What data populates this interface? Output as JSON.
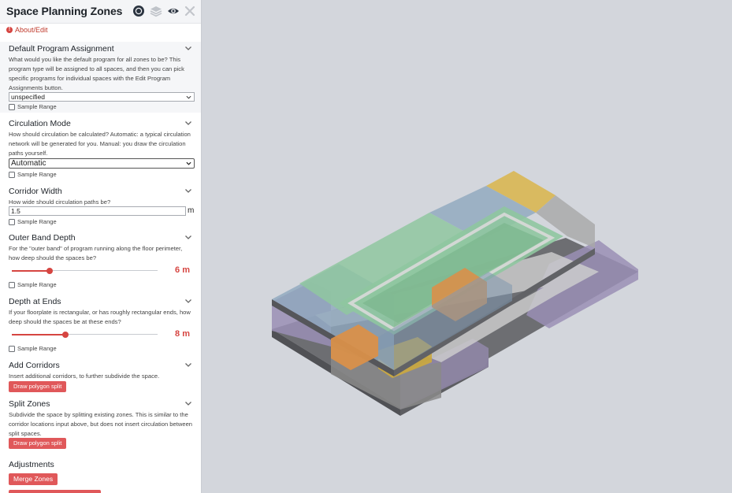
{
  "panel": {
    "title": "Space Planning Zones",
    "about_label": "About/Edit",
    "sections": {
      "default_program": {
        "title": "Default Program Assignment",
        "description": "What would you like the default program for all zones to be? This program type will be assigned to all spaces, and then you can pick specific programs for individual spaces with the Edit Program Assignments button.",
        "value": "unspecified",
        "sample_label": "Sample Range"
      },
      "circulation_mode": {
        "title": "Circulation Mode",
        "description": "How should circulation be calculated? Automatic: a typical circulation network will be generated for you. Manual: you draw the circulation paths yourself.",
        "value": "Automatic",
        "sample_label": "Sample Range"
      },
      "corridor_width": {
        "title": "Corridor Width",
        "description": "How wide should circulation paths be?",
        "value": "1.5",
        "unit": "m",
        "sample_label": "Sample Range"
      },
      "outer_band_depth": {
        "title": "Outer Band Depth",
        "description": "For the \"outer band\" of program running along the floor perimeter, how deep should the spaces be?",
        "value_label": "6 m",
        "slider_fraction": 0.26,
        "sample_label": "Sample Range"
      },
      "depth_at_ends": {
        "title": "Depth at Ends",
        "description": "If your floorplate is rectangular, or has roughly rectangular ends, how deep should the spaces be at these ends?",
        "value_label": "8 m",
        "slider_fraction": 0.37,
        "sample_label": "Sample Range"
      },
      "add_corridors": {
        "title": "Add Corridors",
        "description": "Insert additional corridors, to further subdivide the space.",
        "button": "Draw polygon split"
      },
      "split_zones": {
        "title": "Split Zones",
        "description": "Subdivide the space by splitting existing zones. This is similar to the corridor locations input above, but does not insert circulation between split spaces.",
        "button": "Draw polygon split"
      },
      "adjustments": {
        "title": "Adjustments",
        "button": "Merge Zones"
      }
    }
  },
  "icons": {
    "header": [
      "circle-record-icon",
      "layers-icon",
      "eye-icon",
      "close-icon"
    ],
    "about": "info-icon",
    "section": "chevron-down-icon"
  },
  "colors": {
    "accent_red": "#d64541",
    "button_red": "#e0585a",
    "viewport_bg": "#d3d6dc",
    "zone_green": "#8fc7a0",
    "zone_blue": "#8fa7be",
    "zone_yellow": "#d9b54a",
    "zone_orange": "#d9904a",
    "zone_purple": "#9a8fb5",
    "zone_gray": "#8a8a8a",
    "circulation": "#c9c9c9"
  }
}
